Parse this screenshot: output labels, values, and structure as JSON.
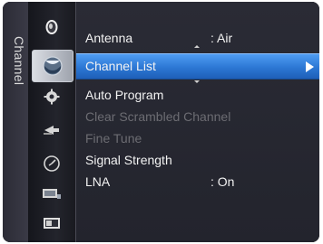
{
  "sidebar": {
    "title": "Channel"
  },
  "icons": [
    {
      "name": "picture-icon"
    },
    {
      "name": "sound-icon"
    },
    {
      "name": "channel-icon",
      "active": true
    },
    {
      "name": "setup-icon"
    },
    {
      "name": "input-icon"
    },
    {
      "name": "clock-icon"
    },
    {
      "name": "application-icon"
    },
    {
      "name": "support-icon"
    }
  ],
  "menu": {
    "antenna": {
      "label": "Antenna",
      "value": ": Air"
    },
    "channel_list": {
      "label": "Channel List",
      "selected": true
    },
    "auto_program": {
      "label": "Auto Program"
    },
    "clear_scrambled": {
      "label": "Clear Scrambled Channel",
      "enabled": false
    },
    "fine_tune": {
      "label": "Fine Tune",
      "enabled": false
    },
    "signal_strength": {
      "label": "Signal Strength"
    },
    "lna": {
      "label": "LNA",
      "value": ": On"
    }
  },
  "colors": {
    "highlight": "#2c77d4",
    "text": "#f2f2f2",
    "disabled_text": "#6c6c72",
    "background": "#23242d"
  }
}
